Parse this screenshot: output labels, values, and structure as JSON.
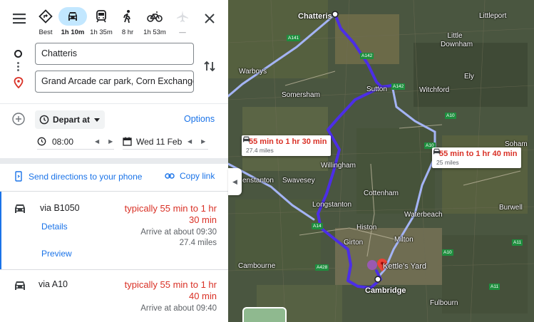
{
  "modes": [
    {
      "name": "Best",
      "time": "Best",
      "icon": "directions-icon",
      "active": false
    },
    {
      "name": "Car",
      "time": "1h 10m",
      "icon": "car-icon",
      "active": true
    },
    {
      "name": "Transit",
      "time": "1h 35m",
      "icon": "train-icon",
      "active": false
    },
    {
      "name": "Walking",
      "time": "8 hr",
      "icon": "walking-icon",
      "active": false
    },
    {
      "name": "Cycling",
      "time": "1h 53m",
      "icon": "bicycle-icon",
      "active": false
    },
    {
      "name": "Flights",
      "time": "—",
      "icon": "flight-icon",
      "active": false
    }
  ],
  "start": {
    "value": "Chatteris"
  },
  "destination": {
    "value": "Grand Arcade car park, Corn Exchange S"
  },
  "depart": {
    "label": "Depart at",
    "time": "08:00",
    "date": "Wed 11 Feb"
  },
  "options_label": "Options",
  "actions": {
    "send": "Send directions to your phone",
    "copy": "Copy link"
  },
  "routes": [
    {
      "via": "via B1050",
      "duration": "typically 55 min to 1 hr 30 min",
      "arrive": "Arrive at about 09:30",
      "distance": "27.4 miles",
      "details": "Details",
      "preview": "Preview"
    },
    {
      "via": "via A10",
      "duration": "typically 55 min to 1 hr 40 min",
      "arrive": "Arrive at about 09:40"
    }
  ],
  "map": {
    "callout1": {
      "duration": "55 min to 1 hr 30 min",
      "distance": "27.4 miles"
    },
    "callout2": {
      "duration": "55 min to 1 hr 40 min",
      "distance": "25 miles"
    },
    "places": {
      "chatteris": "Chatteris",
      "littleport": "Littleport",
      "little_downham": "Little Downham",
      "warboys": "Warboys",
      "somersham": "Somersham",
      "ely": "Ely",
      "sutton": "Sutton",
      "witchford": "Witchford",
      "soham": "Soham",
      "willingham": "Willingham",
      "stanton": "enstanton",
      "swavesey": "Swavesey",
      "cottenham": "Cottenham",
      "longstanton": "Longstanton",
      "waterbeach": "Waterbeach",
      "burwell": "Burwell",
      "histon": "Histon",
      "girton": "Girton",
      "milton": "Milton",
      "kettles_yard": "Kettle's Yard",
      "cambourne": "Cambourne",
      "cambridge": "Cambridge",
      "fulbourn": "Fulbourn"
    },
    "roads": {
      "a141a": "A141",
      "a142a": "A142",
      "a142b": "A142",
      "a10a": "A10",
      "a10b": "A10",
      "a10c": "A10",
      "a14": "A14",
      "a428": "A428",
      "a11a": "A11",
      "a11b": "A11"
    },
    "colors": {
      "primary_route": "#4c2ee6",
      "alt_route": "#a4b4f5",
      "duration_red": "#d93025"
    }
  }
}
